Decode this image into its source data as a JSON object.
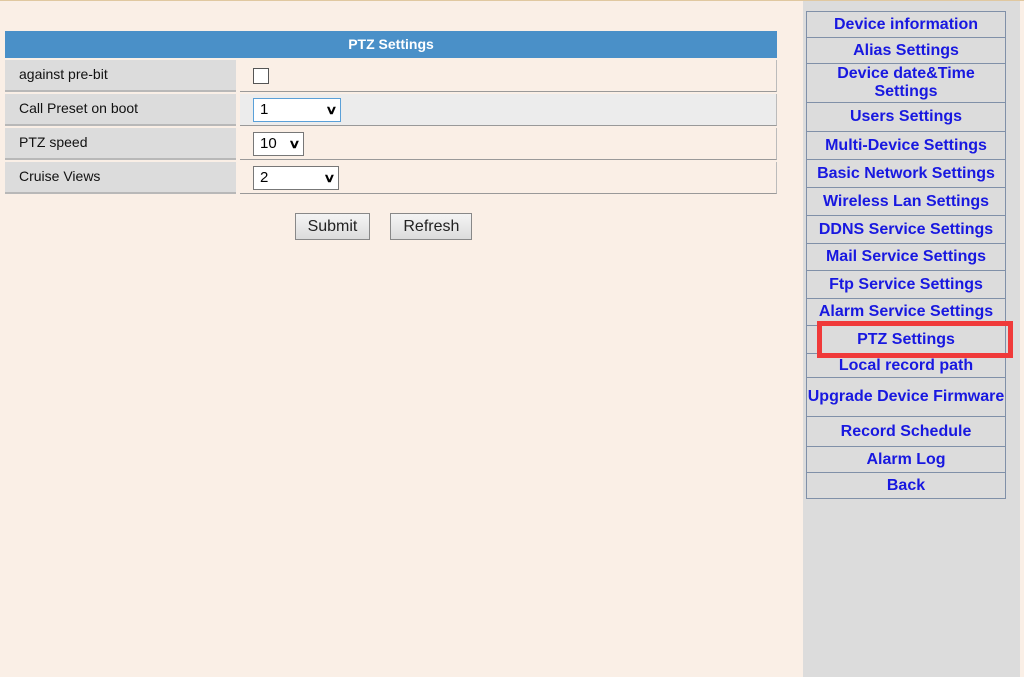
{
  "panel": {
    "title": "PTZ Settings",
    "rows": [
      {
        "label": "against pre-bit",
        "type": "checkbox",
        "checked": false
      },
      {
        "label": "Call Preset on boot",
        "type": "select",
        "value": "1"
      },
      {
        "label": "PTZ speed",
        "type": "select",
        "value": "10"
      },
      {
        "label": "Cruise Views",
        "type": "select",
        "value": "2"
      }
    ],
    "submit": "Submit",
    "refresh": "Refresh"
  },
  "sidebar": {
    "active": "PTZ Settings",
    "highlight_color": "#f03a3a",
    "items": [
      "Device information",
      "Alias Settings",
      "Device date&Time Settings",
      "Users Settings",
      "Multi-Device Settings",
      "Basic Network Settings",
      "Wireless Lan Settings",
      "DDNS Service Settings",
      "Mail Service Settings",
      "Ftp Service Settings",
      "Alarm Service Settings",
      "PTZ Settings",
      "Local record path",
      "Upgrade Device Firmware",
      "Record Schedule",
      "Alarm Log",
      "Back"
    ]
  }
}
